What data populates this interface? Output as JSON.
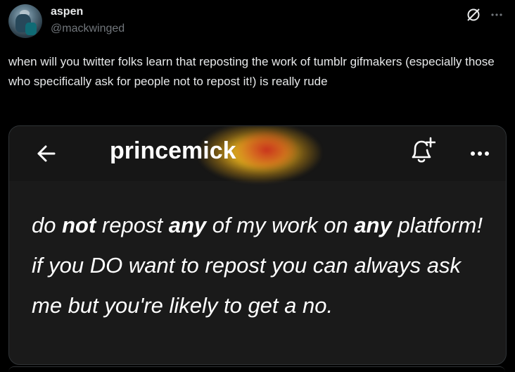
{
  "author": {
    "display_name": "aspen",
    "handle": "@mackwinged"
  },
  "tweet": {
    "text": "when will you twitter folks learn that reposting the work of tumblr gifmakers (especially those who specifically ask for people not to repost it!) is really rude"
  },
  "header_icons": {
    "block": "no-entry-icon",
    "more": "more-icon"
  },
  "media": {
    "blog_name": "princemick",
    "icons": [
      "back-arrow-icon",
      "bell-plus-icon",
      "more-dots-icon"
    ],
    "quote": {
      "p1": "do ",
      "b1": "not",
      "p2": " repost ",
      "b2": "any",
      "p3": " of my work on ",
      "b3": "any",
      "p4": " platform! if you DO want to repost you can always ask me but you're likely to get a no."
    }
  },
  "colors": {
    "background": "#000000",
    "text": "#e7e9ea",
    "secondary": "#71767b",
    "border": "#2f3336"
  }
}
